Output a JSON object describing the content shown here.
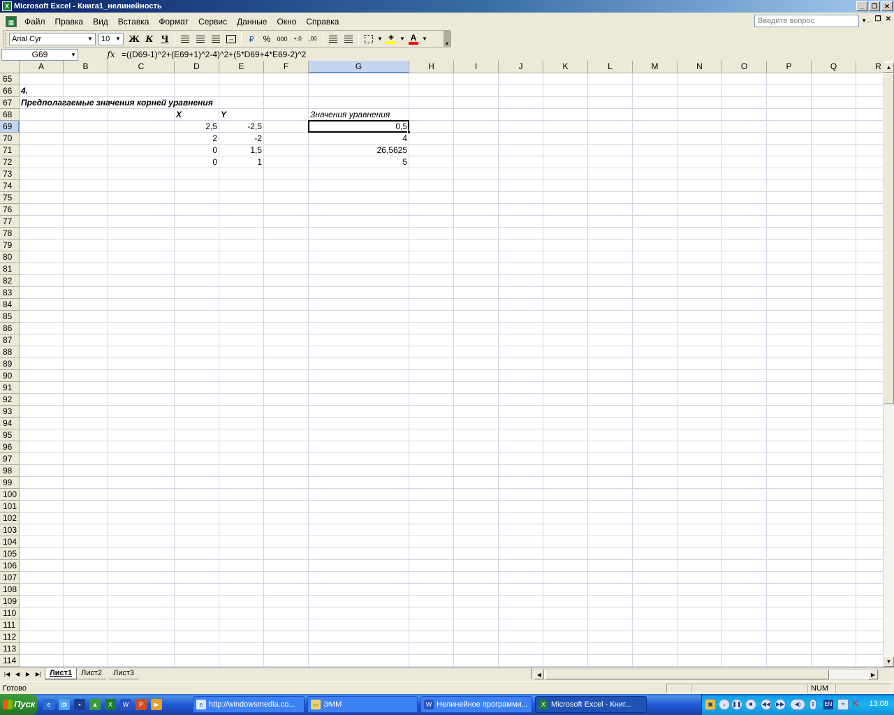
{
  "window": {
    "title": "Microsoft Excel - Книга1_нелинейность",
    "app_icon": "X"
  },
  "menu": {
    "items": [
      {
        "label": "Файл"
      },
      {
        "label": "Правка"
      },
      {
        "label": "Вид"
      },
      {
        "label": "Вставка"
      },
      {
        "label": "Формат"
      },
      {
        "label": "Сервис"
      },
      {
        "label": "Данные"
      },
      {
        "label": "Окно"
      },
      {
        "label": "Справка"
      }
    ],
    "help_placeholder": "Введите вопрос"
  },
  "toolbar": {
    "font_name": "Arial Cyr",
    "font_size": "10",
    "bold": "Ж",
    "italic": "К",
    "underline": "Ч",
    "percent": "%",
    "thousands": "000",
    "inc_decimal": "+,0",
    "dec_decimal": ",00",
    "font_color_glyph": "A",
    "font_color": "#ff0000",
    "fill_color": "#ffff00"
  },
  "formula_bar": {
    "name_box": "G69",
    "fx_label": "fx",
    "formula": "=((D69-1)^2+(E69+1)^2-4)^2+(5*D69+4*E69-2)^2"
  },
  "grid": {
    "columns": [
      "A",
      "B",
      "C",
      "D",
      "E",
      "F",
      "G",
      "H",
      "I",
      "J",
      "K",
      "L",
      "M",
      "N",
      "O",
      "P",
      "Q",
      "R"
    ],
    "selected_column": "G",
    "first_row": 65,
    "last_row": 114,
    "selected_row": 69,
    "cells": {
      "A66": "4.",
      "A67": "Предполагаемые значения корней уравнения",
      "D68": "X",
      "E68": "Y",
      "G68": "Значения уравнения",
      "D69": "2,5",
      "E69": "-2,5",
      "G69": "0,5",
      "D70": "2",
      "E70": "-2",
      "G70": "4",
      "D71": "0",
      "E71": "1,5",
      "G71": "26,5625",
      "D72": "0",
      "E72": "1",
      "G72": "5"
    }
  },
  "sheets": {
    "tabs": [
      "Лист1",
      "Лист2",
      "Лист3"
    ],
    "active": "Лист1"
  },
  "status": {
    "text": "Готово",
    "num": "NUM"
  },
  "taskbar": {
    "start_label": "Пуск",
    "tasks": [
      {
        "label": "http://windowsmedia.co..."
      },
      {
        "label": "ЭММ"
      },
      {
        "label": "Нелинейное программи..."
      },
      {
        "label": "Microsoft Excel - Книг..."
      }
    ],
    "lang": "EN",
    "clock": "13:08"
  }
}
